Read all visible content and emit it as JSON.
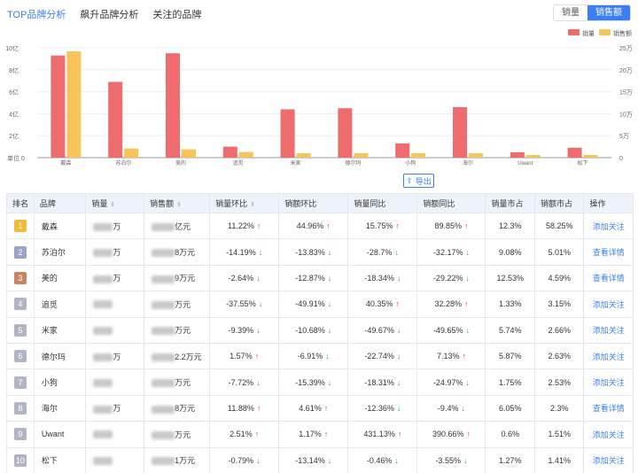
{
  "tabs": [
    {
      "label": "TOP品牌分析",
      "active": true
    },
    {
      "label": "飙升品牌分析",
      "active": false
    },
    {
      "label": "关注的品牌",
      "active": false
    }
  ],
  "toggle": {
    "options": [
      "销量",
      "销售额"
    ],
    "selected": "销售额"
  },
  "export_label": "导出",
  "colors": {
    "sales_volume": "#ee6b6e",
    "sales_amount": "#f7c45b",
    "accent": "#3b7ef6",
    "up": "#f04040",
    "down": "#26b34b"
  },
  "chart_data": {
    "type": "bar",
    "categories": [
      "戴森",
      "苏泊尔",
      "美的",
      "追觅",
      "米家",
      "德尔玛",
      "小狗",
      "海尔",
      "Uwant",
      "松下"
    ],
    "series": [
      {
        "name": "销量",
        "axis": "left",
        "values": [
          9.3,
          6.9,
          9.5,
          1.0,
          4.4,
          4.5,
          1.3,
          4.6,
          0.5,
          0.9
        ]
      },
      {
        "name": "销售额",
        "axis": "right",
        "values": [
          24.2,
          2.1,
          1.9,
          1.3,
          1.0,
          1.0,
          1.0,
          1.0,
          0.6,
          0.6
        ]
      }
    ],
    "left_axis": {
      "ticks": [
        "0",
        "2亿",
        "4亿",
        "6亿",
        "8亿",
        "10亿"
      ],
      "min": 0,
      "max": 10,
      "label": "单位"
    },
    "right_axis": {
      "ticks": [
        "0",
        "5万",
        "10万",
        "15万",
        "20万",
        "25万"
      ],
      "min": 0,
      "max": 25
    },
    "legend": [
      "销量",
      "销售额"
    ],
    "legend_position": "top-right"
  },
  "table": {
    "headers": [
      "排名",
      "品牌",
      "销量",
      "销售额",
      "销量环比",
      "销额环比",
      "销量同比",
      "销额同比",
      "销量市占",
      "销额市占",
      "操作"
    ],
    "rows": [
      {
        "rank": "1",
        "brand": "戴森",
        "vol": "万",
        "amt": "亿元",
        "vol_mom": "11.22%",
        "vol_mom_dir": "up",
        "amt_mom": "44.96%",
        "amt_mom_dir": "up",
        "vol_yoy": "15.75%",
        "vol_yoy_dir": "up",
        "amt_yoy": "89.85%",
        "amt_yoy_dir": "up",
        "vol_share": "12.3%",
        "amt_share": "58.25%",
        "op": "添加关注"
      },
      {
        "rank": "2",
        "brand": "苏泊尔",
        "vol": "万",
        "amt": "8万元",
        "vol_mom": "-14.19%",
        "vol_mom_dir": "down",
        "amt_mom": "-13.83%",
        "amt_mom_dir": "down",
        "vol_yoy": "-28.7%",
        "vol_yoy_dir": "down",
        "amt_yoy": "-32.17%",
        "amt_yoy_dir": "down",
        "vol_share": "9.08%",
        "amt_share": "5.01%",
        "op": "查看详情"
      },
      {
        "rank": "3",
        "brand": "美的",
        "vol": "万",
        "amt": "9万元",
        "vol_mom": "-2.64%",
        "vol_mom_dir": "down",
        "amt_mom": "-12.87%",
        "amt_mom_dir": "down",
        "vol_yoy": "-18.34%",
        "vol_yoy_dir": "down",
        "amt_yoy": "-29.22%",
        "amt_yoy_dir": "down",
        "vol_share": "12.53%",
        "amt_share": "4.59%",
        "op": "查看详情"
      },
      {
        "rank": "4",
        "brand": "追觅",
        "vol": "",
        "amt": "万元",
        "vol_mom": "-37.55%",
        "vol_mom_dir": "down",
        "amt_mom": "-49.91%",
        "amt_mom_dir": "down",
        "vol_yoy": "40.35%",
        "vol_yoy_dir": "up",
        "amt_yoy": "32.28%",
        "amt_yoy_dir": "up",
        "vol_share": "1.33%",
        "amt_share": "3.15%",
        "op": "添加关注"
      },
      {
        "rank": "5",
        "brand": "米家",
        "vol": "",
        "amt": "万元",
        "vol_mom": "-9.39%",
        "vol_mom_dir": "down",
        "amt_mom": "-10.68%",
        "amt_mom_dir": "down",
        "vol_yoy": "-49.67%",
        "vol_yoy_dir": "down",
        "amt_yoy": "-49.65%",
        "amt_yoy_dir": "down",
        "vol_share": "5.74%",
        "amt_share": "2.66%",
        "op": "添加关注"
      },
      {
        "rank": "6",
        "brand": "德尔玛",
        "vol": "万",
        "amt": "2.2万元",
        "vol_mom": "1.57%",
        "vol_mom_dir": "up",
        "amt_mom": "-6.91%",
        "amt_mom_dir": "down",
        "vol_yoy": "-22.74%",
        "vol_yoy_dir": "down",
        "amt_yoy": "7.13%",
        "amt_yoy_dir": "up",
        "vol_share": "5.87%",
        "amt_share": "2.63%",
        "op": "添加关注"
      },
      {
        "rank": "7",
        "brand": "小狗",
        "vol": "",
        "amt": "万元",
        "vol_mom": "-7.72%",
        "vol_mom_dir": "down",
        "amt_mom": "-15.39%",
        "amt_mom_dir": "down",
        "vol_yoy": "-18.31%",
        "vol_yoy_dir": "down",
        "amt_yoy": "-24.97%",
        "amt_yoy_dir": "down",
        "vol_share": "1.75%",
        "amt_share": "2.53%",
        "op": "添加关注"
      },
      {
        "rank": "8",
        "brand": "海尔",
        "vol": "万",
        "amt": "8万元",
        "vol_mom": "11.88%",
        "vol_mom_dir": "up",
        "amt_mom": "4.61%",
        "amt_mom_dir": "up",
        "vol_yoy": "-12.36%",
        "vol_yoy_dir": "down",
        "amt_yoy": "-9.4%",
        "amt_yoy_dir": "down",
        "vol_share": "6.05%",
        "amt_share": "2.3%",
        "op": "查看详情"
      },
      {
        "rank": "9",
        "brand": "Uwant",
        "vol": "",
        "amt": "万元",
        "vol_mom": "2.51%",
        "vol_mom_dir": "up",
        "amt_mom": "1.17%",
        "amt_mom_dir": "up",
        "vol_yoy": "431.13%",
        "vol_yoy_dir": "up",
        "amt_yoy": "390.66%",
        "amt_yoy_dir": "up",
        "vol_share": "0.6%",
        "amt_share": "1.51%",
        "op": "添加关注"
      },
      {
        "rank": "10",
        "brand": "松下",
        "vol": "",
        "amt": "1万元",
        "vol_mom": "-0.79%",
        "vol_mom_dir": "down",
        "amt_mom": "-13.14%",
        "amt_mom_dir": "down",
        "vol_yoy": "-0.46%",
        "vol_yoy_dir": "down",
        "amt_yoy": "-3.55%",
        "amt_yoy_dir": "down",
        "vol_share": "1.27%",
        "amt_share": "1.41%",
        "op": "添加关注"
      }
    ]
  }
}
